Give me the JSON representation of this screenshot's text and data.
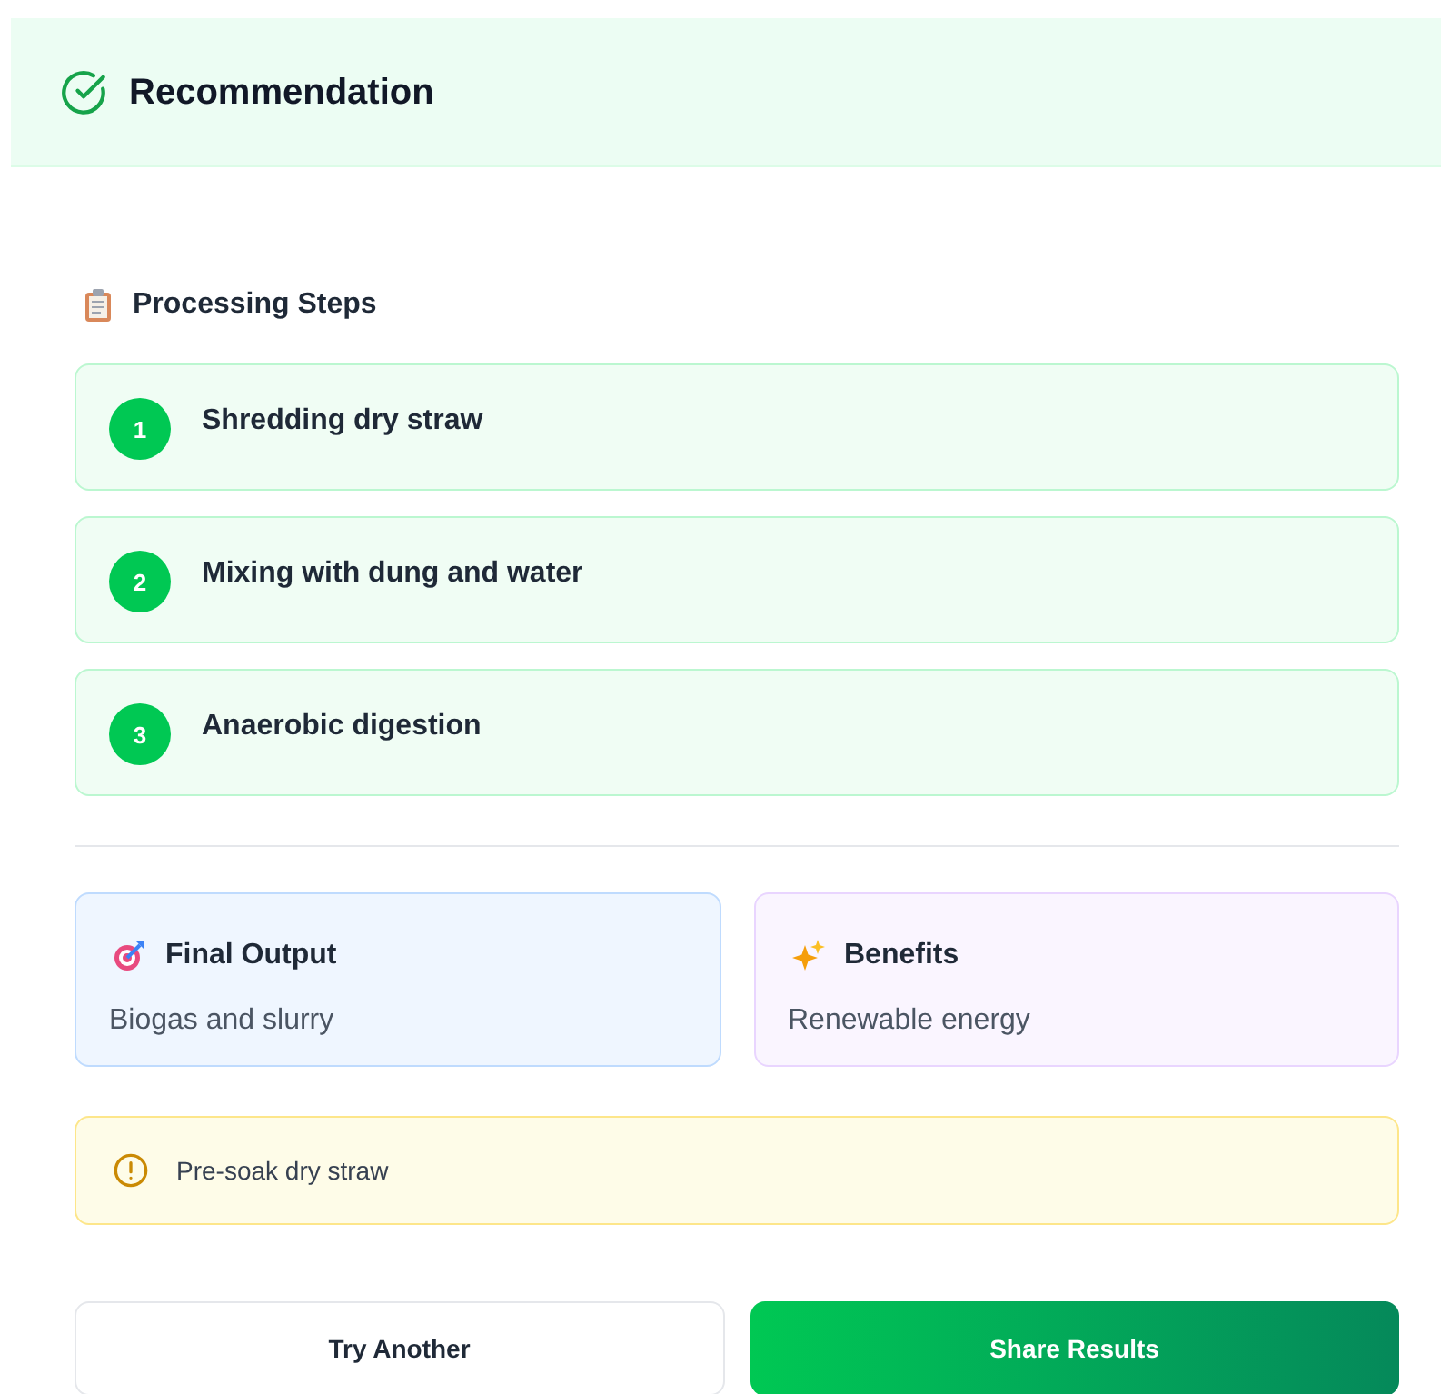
{
  "header": {
    "title": "Recommendation"
  },
  "steps_section": {
    "title": "Processing Steps",
    "steps": [
      {
        "number": "1",
        "text": "Shredding dry straw"
      },
      {
        "number": "2",
        "text": "Mixing with dung and water"
      },
      {
        "number": "3",
        "text": "Anaerobic digestion"
      }
    ]
  },
  "info_cards": [
    {
      "kind": "output",
      "title": "Final Output",
      "text": "Biogas and slurry"
    },
    {
      "kind": "benefits",
      "title": "Benefits",
      "text": "Renewable energy"
    }
  ],
  "tip": {
    "text": "Pre-soak dry straw"
  },
  "buttons": [
    {
      "kind": "secondary",
      "label": "Try Another"
    },
    {
      "kind": "primary",
      "label": "Share Results"
    }
  ]
}
